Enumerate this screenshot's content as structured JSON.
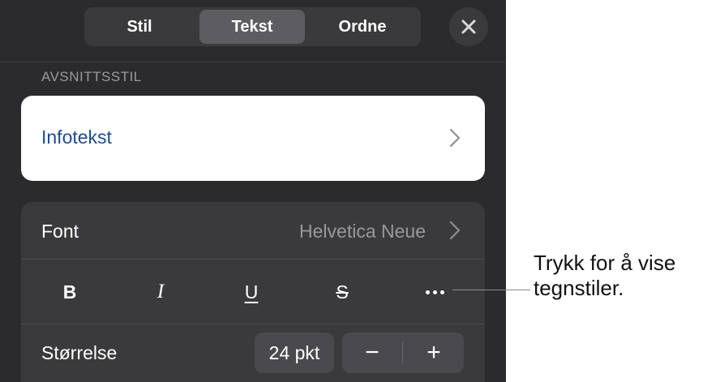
{
  "tabs": [
    {
      "label": "Stil",
      "selected": false
    },
    {
      "label": "Tekst",
      "selected": true
    },
    {
      "label": "Ordne",
      "selected": false
    }
  ],
  "close_icon": "close-icon",
  "paragraph_style": {
    "section_label": "AVSNITTSSTIL",
    "value": "Infotekst",
    "chevron_icon": "chevron-right-icon"
  },
  "font": {
    "label": "Font",
    "value": "Helvetica Neue",
    "chevron_icon": "chevron-right-icon"
  },
  "format_buttons": {
    "bold": "B",
    "italic": "I",
    "underline": "U",
    "strikethrough": "S",
    "more_icon": "ellipsis-icon"
  },
  "size": {
    "label": "Størrelse",
    "value": "24 pkt",
    "decrease_label": "−",
    "increase_label": "+"
  },
  "callout": {
    "line1": "Trykk for å vise",
    "line2": "tegnstiler."
  },
  "colors": {
    "panel": "#2b2b2d",
    "card": "#3a3a3c",
    "selected_tab": "#5d5d61",
    "style_text": "#1e4b8f"
  }
}
